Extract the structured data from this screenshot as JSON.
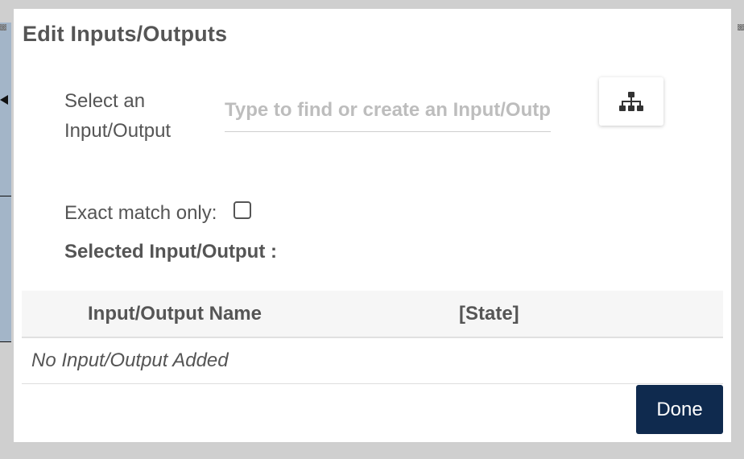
{
  "dialog": {
    "title": "Edit Inputs/Outputs",
    "select_label": "Select an Input/Output",
    "search": {
      "placeholder": "Type to find or create an Input/Output",
      "value": ""
    },
    "hierarchy_button_icon": "sitemap-icon",
    "exact_match_label": "Exact match only:",
    "exact_match_checked": false,
    "selected_label": "Selected Input/Output :",
    "table": {
      "columns": [
        "Input/Output Name",
        "[State]"
      ],
      "empty_message": "No Input/Output Added"
    },
    "done_label": "Done"
  },
  "colors": {
    "done_button": "#0f2a4e",
    "text": "#555555",
    "placeholder": "#bdbdbd",
    "backdrop": "#cfcfcf"
  }
}
